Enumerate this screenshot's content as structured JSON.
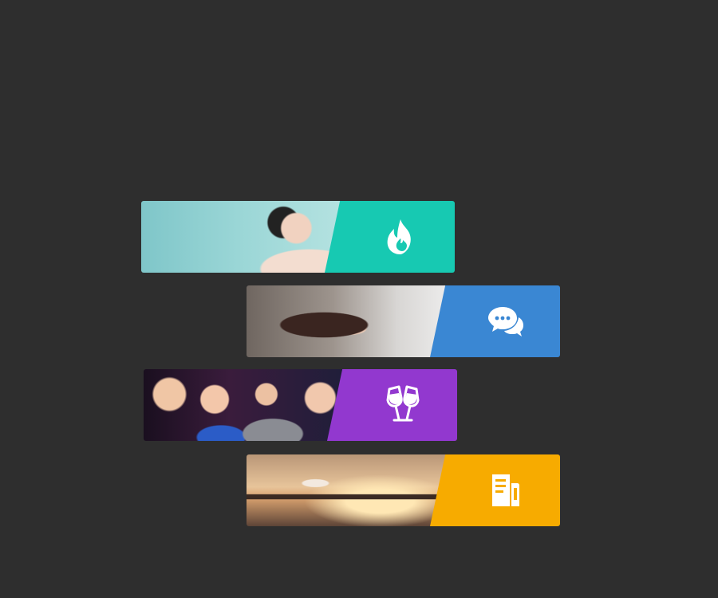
{
  "background_color": "#2e2e2e",
  "cards": [
    {
      "id": "hot",
      "accent": "#17c9b2",
      "icon": "fire-icon"
    },
    {
      "id": "chat",
      "accent": "#3a87d3",
      "icon": "chat-bubbles-icon"
    },
    {
      "id": "party",
      "accent": "#9238cf",
      "icon": "champagne-toast-icon"
    },
    {
      "id": "doc",
      "accent": "#f7ab00",
      "icon": "document-icon"
    }
  ]
}
